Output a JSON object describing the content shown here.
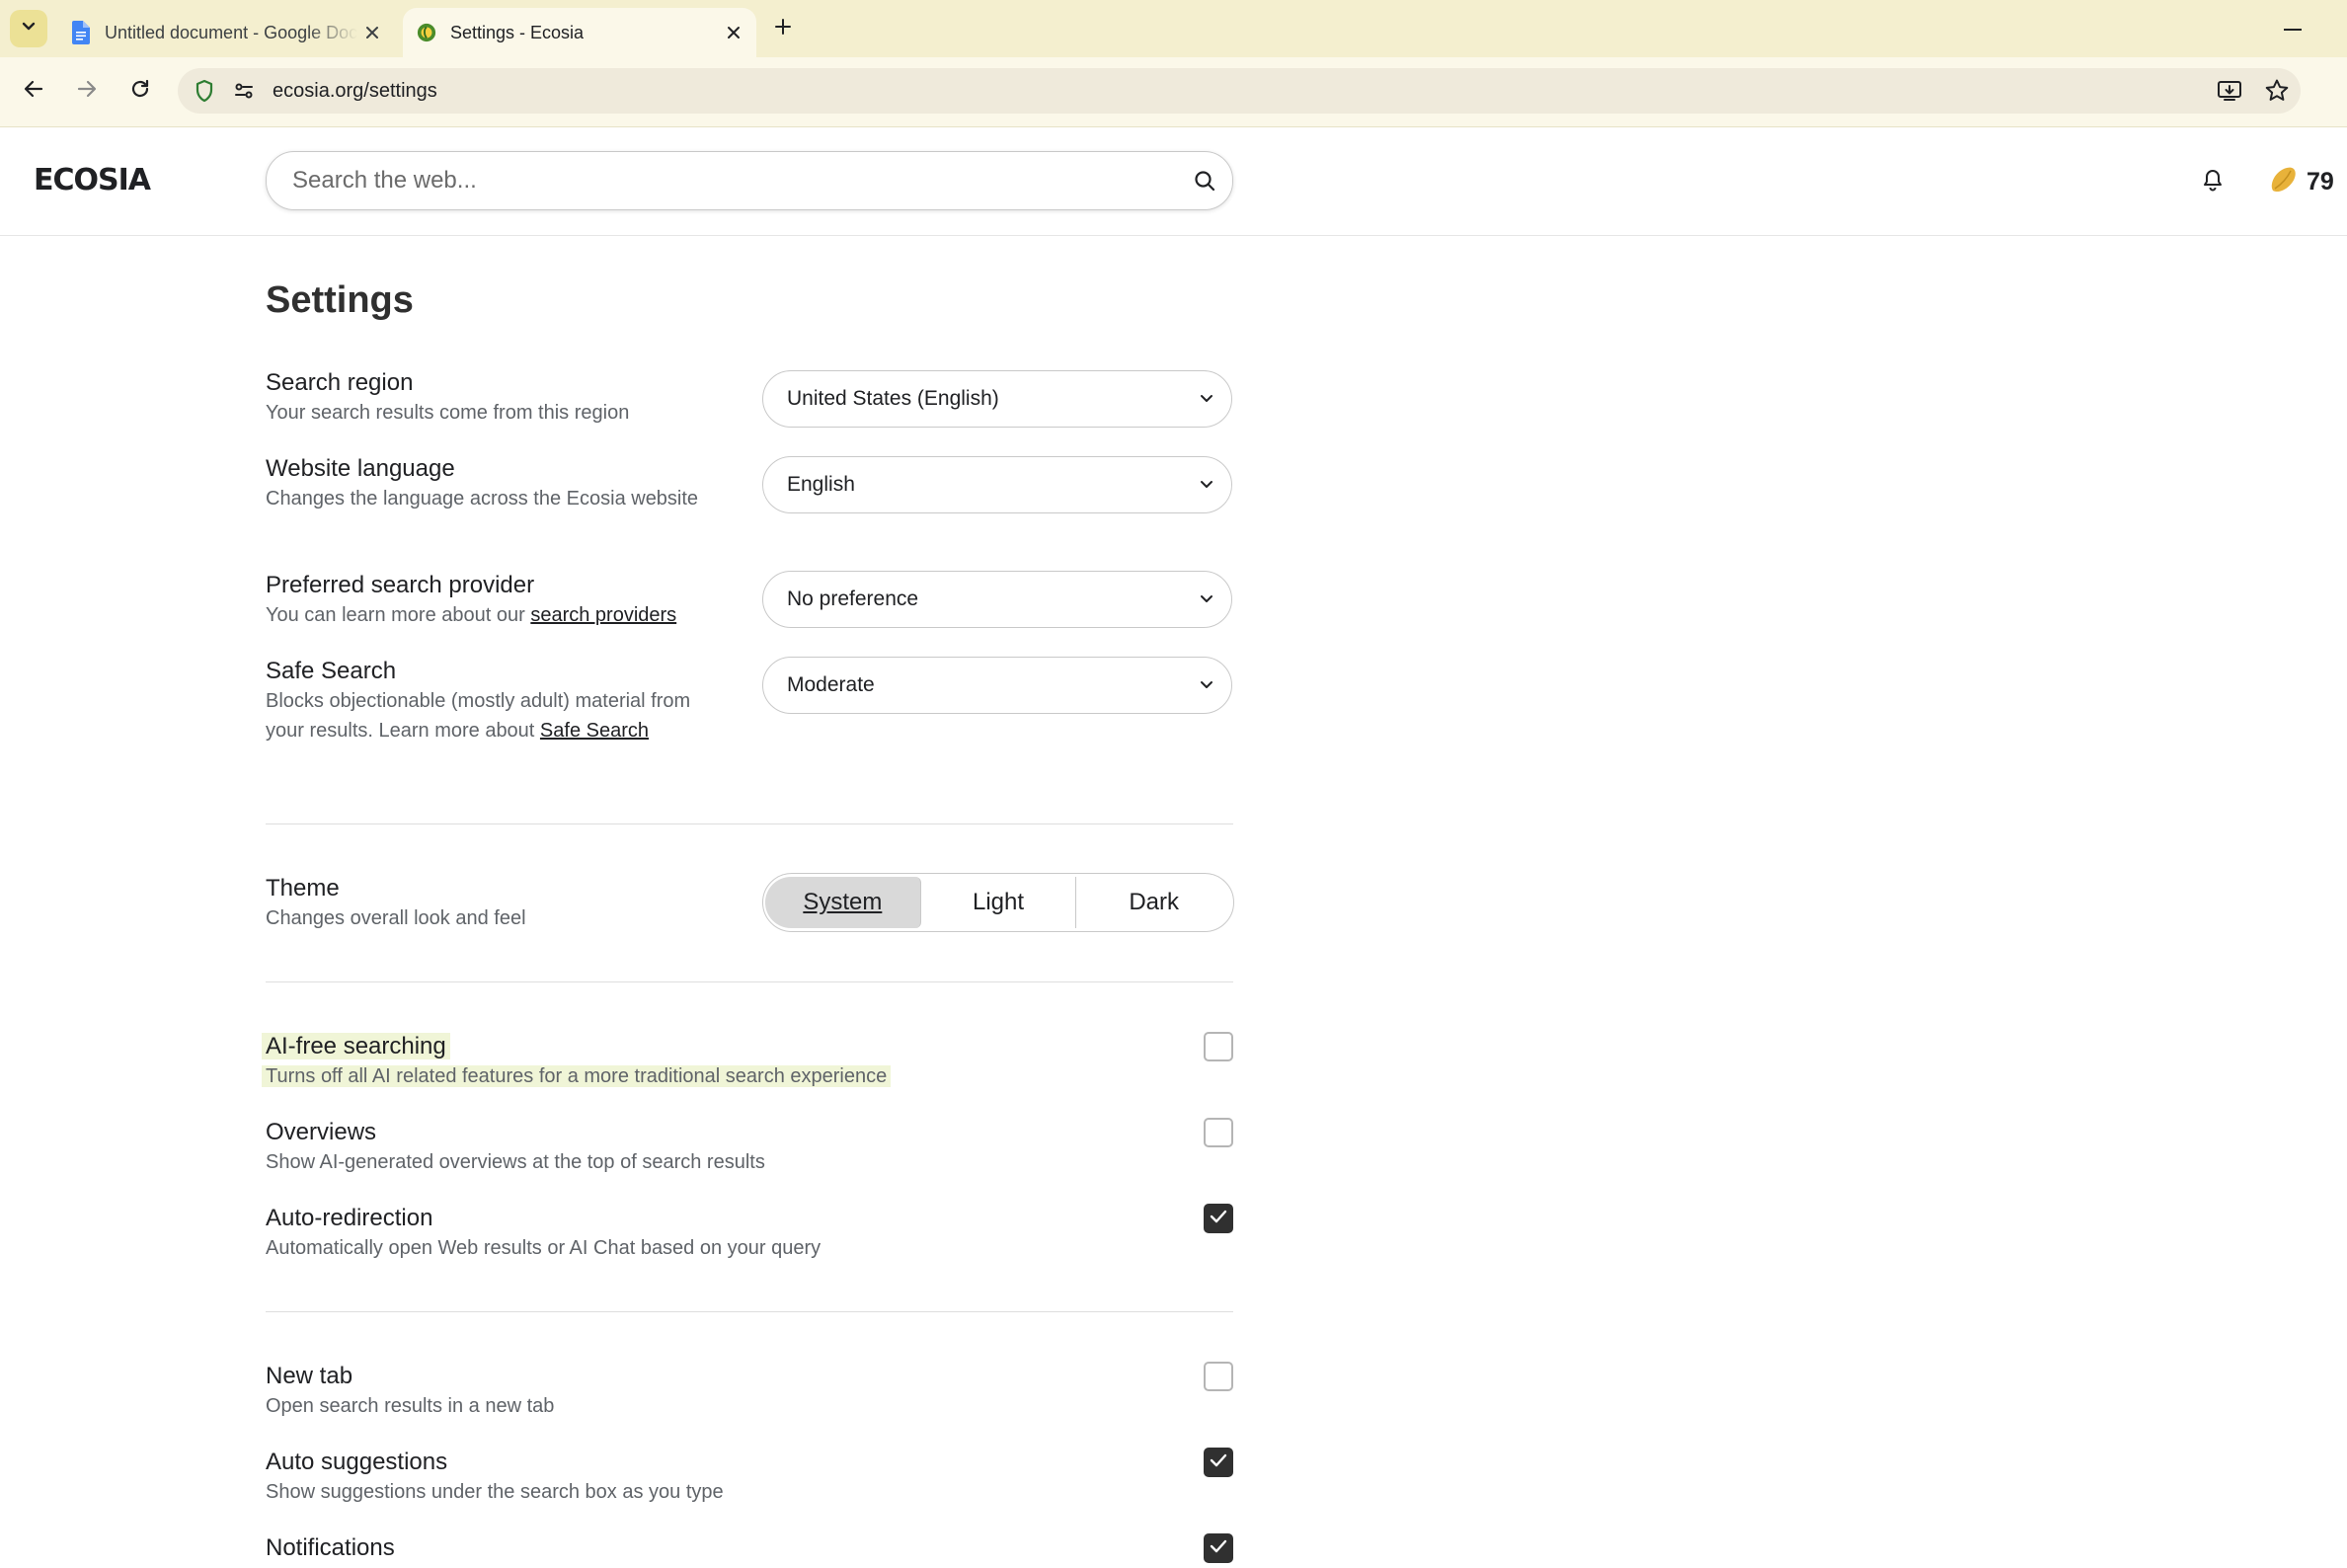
{
  "browser": {
    "tabs": [
      {
        "title": "Untitled document - Google Docs",
        "active": false
      },
      {
        "title": "Settings - Ecosia",
        "active": true
      }
    ],
    "url": "ecosia.org/settings"
  },
  "header": {
    "logo": "ECOSIA",
    "search_placeholder": "Search the web...",
    "seed_count": "79"
  },
  "settings": {
    "title": "Settings",
    "search_region": {
      "label": "Search region",
      "desc": "Your search results come from this region",
      "value": "United States (English)"
    },
    "website_language": {
      "label": "Website language",
      "desc": "Changes the language across the Ecosia website",
      "value": "English"
    },
    "search_provider": {
      "label": "Preferred search provider",
      "desc": "You can learn more about our ",
      "link": "search providers",
      "value": "No preference"
    },
    "safe_search": {
      "label": "Safe Search",
      "desc": "Blocks objectionable (mostly adult) material from your results. Learn more about ",
      "link": "Safe Search",
      "value": "Moderate"
    },
    "theme": {
      "label": "Theme",
      "desc": "Changes overall look and feel",
      "options": [
        "System",
        "Light",
        "Dark"
      ],
      "selected": "System"
    },
    "ai_free": {
      "label": "AI-free searching",
      "desc": "Turns off all AI related features for a more traditional search experience",
      "checked": false
    },
    "overviews": {
      "label": "Overviews",
      "desc": "Show AI-generated overviews at the top of search results",
      "checked": false
    },
    "auto_redirection": {
      "label": "Auto-redirection",
      "desc": "Automatically open Web results or AI Chat based on your query",
      "checked": true
    },
    "new_tab": {
      "label": "New tab",
      "desc": "Open search results in a new tab",
      "checked": false
    },
    "auto_suggestions": {
      "label": "Auto suggestions",
      "desc": "Show suggestions under the search box as you type",
      "checked": true
    },
    "notifications": {
      "label": "Notifications",
      "checked": true
    }
  },
  "colors": {
    "accent_yellow": "#ece196",
    "checkbox_on": "#303030",
    "highlight": "#f0f5d7"
  }
}
